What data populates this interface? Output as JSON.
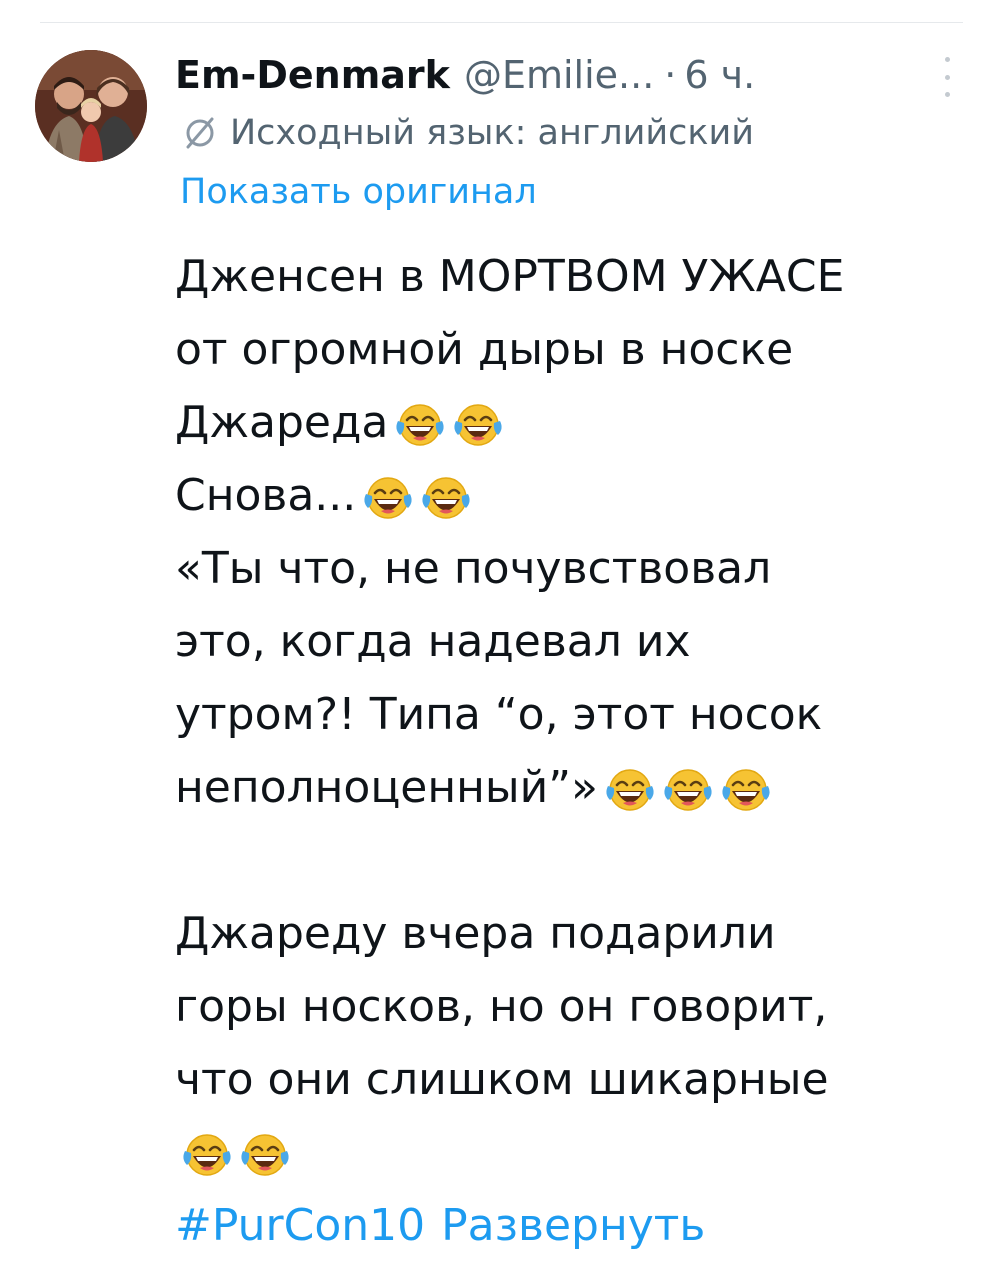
{
  "tweet": {
    "display_name": "Em-Denmark",
    "handle": "@Emilie...",
    "dot": "·",
    "time": "6 ч.",
    "source_language_label": "Исходный язык: английский",
    "show_original_label": "Показать оригинал",
    "lines": [
      {
        "text": "Дженсен в МОРТВОМ УЖАСЕ",
        "emoji_count": 0
      },
      {
        "text": "от огромной дыры в носке",
        "emoji_count": 0
      },
      {
        "text": "Джареда",
        "emoji_count": 2
      },
      {
        "text": "Снова...",
        "emoji_count": 2
      },
      {
        "text": "«Ты что, не почувствовал",
        "emoji_count": 0
      },
      {
        "text": "это, когда надевал их",
        "emoji_count": 0
      },
      {
        "text": "утром?! Типа “о, этот носок",
        "emoji_count": 0
      },
      {
        "text": "неполноценный”»",
        "emoji_count": 3
      },
      {
        "text": "",
        "emoji_count": 0
      },
      {
        "text": "Джареду вчера подарили",
        "emoji_count": 0
      },
      {
        "text": "горы носков, но он говорит,",
        "emoji_count": 0
      },
      {
        "text": "что они слишком шикарные",
        "emoji_count": 0
      },
      {
        "text": "",
        "emoji_count": 2
      }
    ],
    "hashtag": "#PurCon10",
    "expand_label": "Развернуть",
    "emoji_icon": "face-with-tears-of-joy-icon",
    "colors": {
      "link": "#1d9bf0",
      "secondary": "#536471",
      "text": "#0f1419"
    }
  }
}
